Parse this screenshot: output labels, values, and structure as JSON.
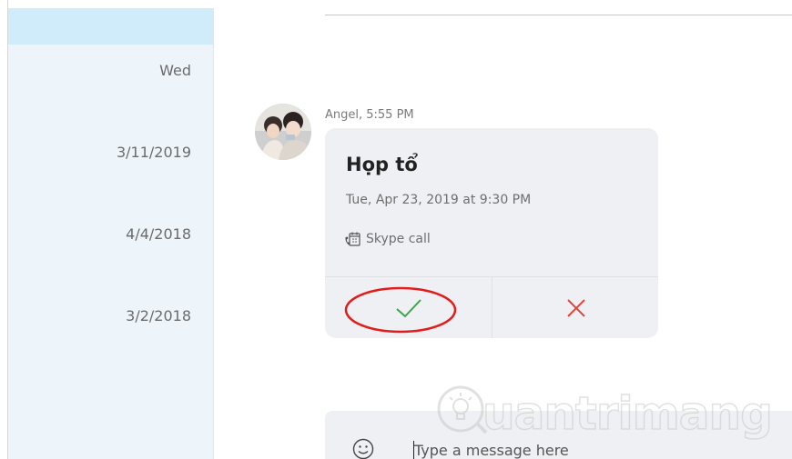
{
  "sidebar": {
    "dates": [
      "Wed",
      "3/11/2019",
      "4/4/2018",
      "3/2/2018"
    ]
  },
  "message": {
    "sender_meta": "Angel, 5:55 PM",
    "card": {
      "title": "Họp tổ",
      "datetime": "Tue, Apr 23, 2019 at 9:30 PM",
      "call_type": "Skype call",
      "accept_icon": "check-icon",
      "decline_icon": "close-icon"
    }
  },
  "compose": {
    "placeholder": "Type a message here",
    "emoji_icon": "smiley-icon"
  },
  "watermark": {
    "text": "uantrimang"
  },
  "colors": {
    "sidebar_bg": "#eef5fa",
    "sidebar_selected": "#d0ecfb",
    "card_bg": "#eff0f3",
    "accept_green": "#3fa34d",
    "decline_red": "#e0443c",
    "annotation_red": "#e21b1b"
  }
}
